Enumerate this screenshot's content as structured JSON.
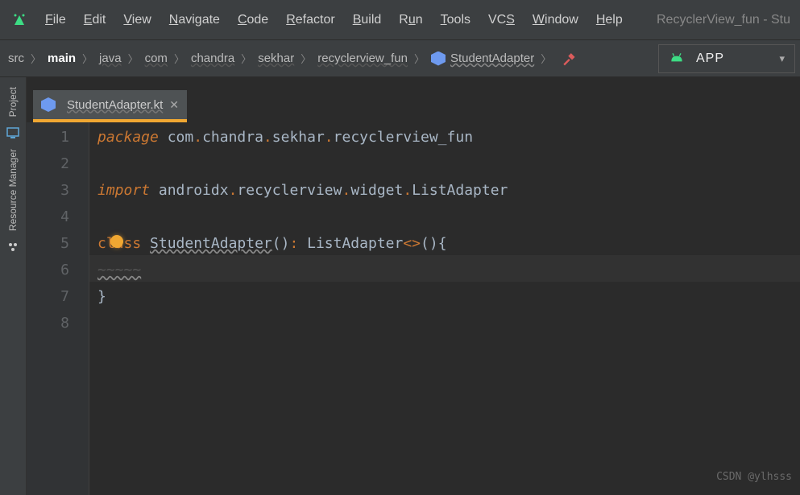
{
  "window_title": "RecyclerView_fun - Stu",
  "menu": [
    {
      "label": "File",
      "u": "F"
    },
    {
      "label": "Edit",
      "u": "E"
    },
    {
      "label": "View",
      "u": "V"
    },
    {
      "label": "Navigate",
      "u": "N"
    },
    {
      "label": "Code",
      "u": "C"
    },
    {
      "label": "Refactor",
      "u": "R"
    },
    {
      "label": "Build",
      "u": "B"
    },
    {
      "label": "Run",
      "u": "u"
    },
    {
      "label": "Tools",
      "u": "T"
    },
    {
      "label": "VCS",
      "u": "S"
    },
    {
      "label": "Window",
      "u": "W"
    },
    {
      "label": "Help",
      "u": "H"
    }
  ],
  "breadcrumbs": [
    {
      "label": "src",
      "bold": false
    },
    {
      "label": "main",
      "bold": true
    },
    {
      "label": "java",
      "bold": false,
      "wavy": true
    },
    {
      "label": "com",
      "bold": false,
      "wavy": true
    },
    {
      "label": "chandra",
      "bold": false,
      "wavy": true
    },
    {
      "label": "sekhar",
      "bold": false,
      "wavy": true
    },
    {
      "label": "recyclerview_fun",
      "bold": false,
      "wavy": true
    },
    {
      "label": "StudentAdapter",
      "bold": false,
      "icon": true,
      "wavy": true
    }
  ],
  "run_config": {
    "label": "APP"
  },
  "sidebar": {
    "project": "Project",
    "resource_manager": "Resource Manager"
  },
  "tab": {
    "name": "StudentAdapter.kt"
  },
  "gutter": [
    "1",
    "2",
    "3",
    "4",
    "5",
    "6",
    "7",
    "8"
  ],
  "code": {
    "l1": {
      "kw": "package",
      "p1": "com",
      "p2": "chandra",
      "p3": "sekhar",
      "p4": "recyclerview_fun"
    },
    "l3": {
      "kw": "import",
      "p1": "androidx",
      "p2": "recyclerview",
      "p3": "widget",
      "p4": "ListAdapter"
    },
    "l5": {
      "kw": "class",
      "name": "StudentAdapter",
      "sup": "ListAdapter"
    },
    "l7": {
      "brace": "}"
    }
  },
  "highlight_line": 6,
  "watermark": "CSDN @ylhsss"
}
